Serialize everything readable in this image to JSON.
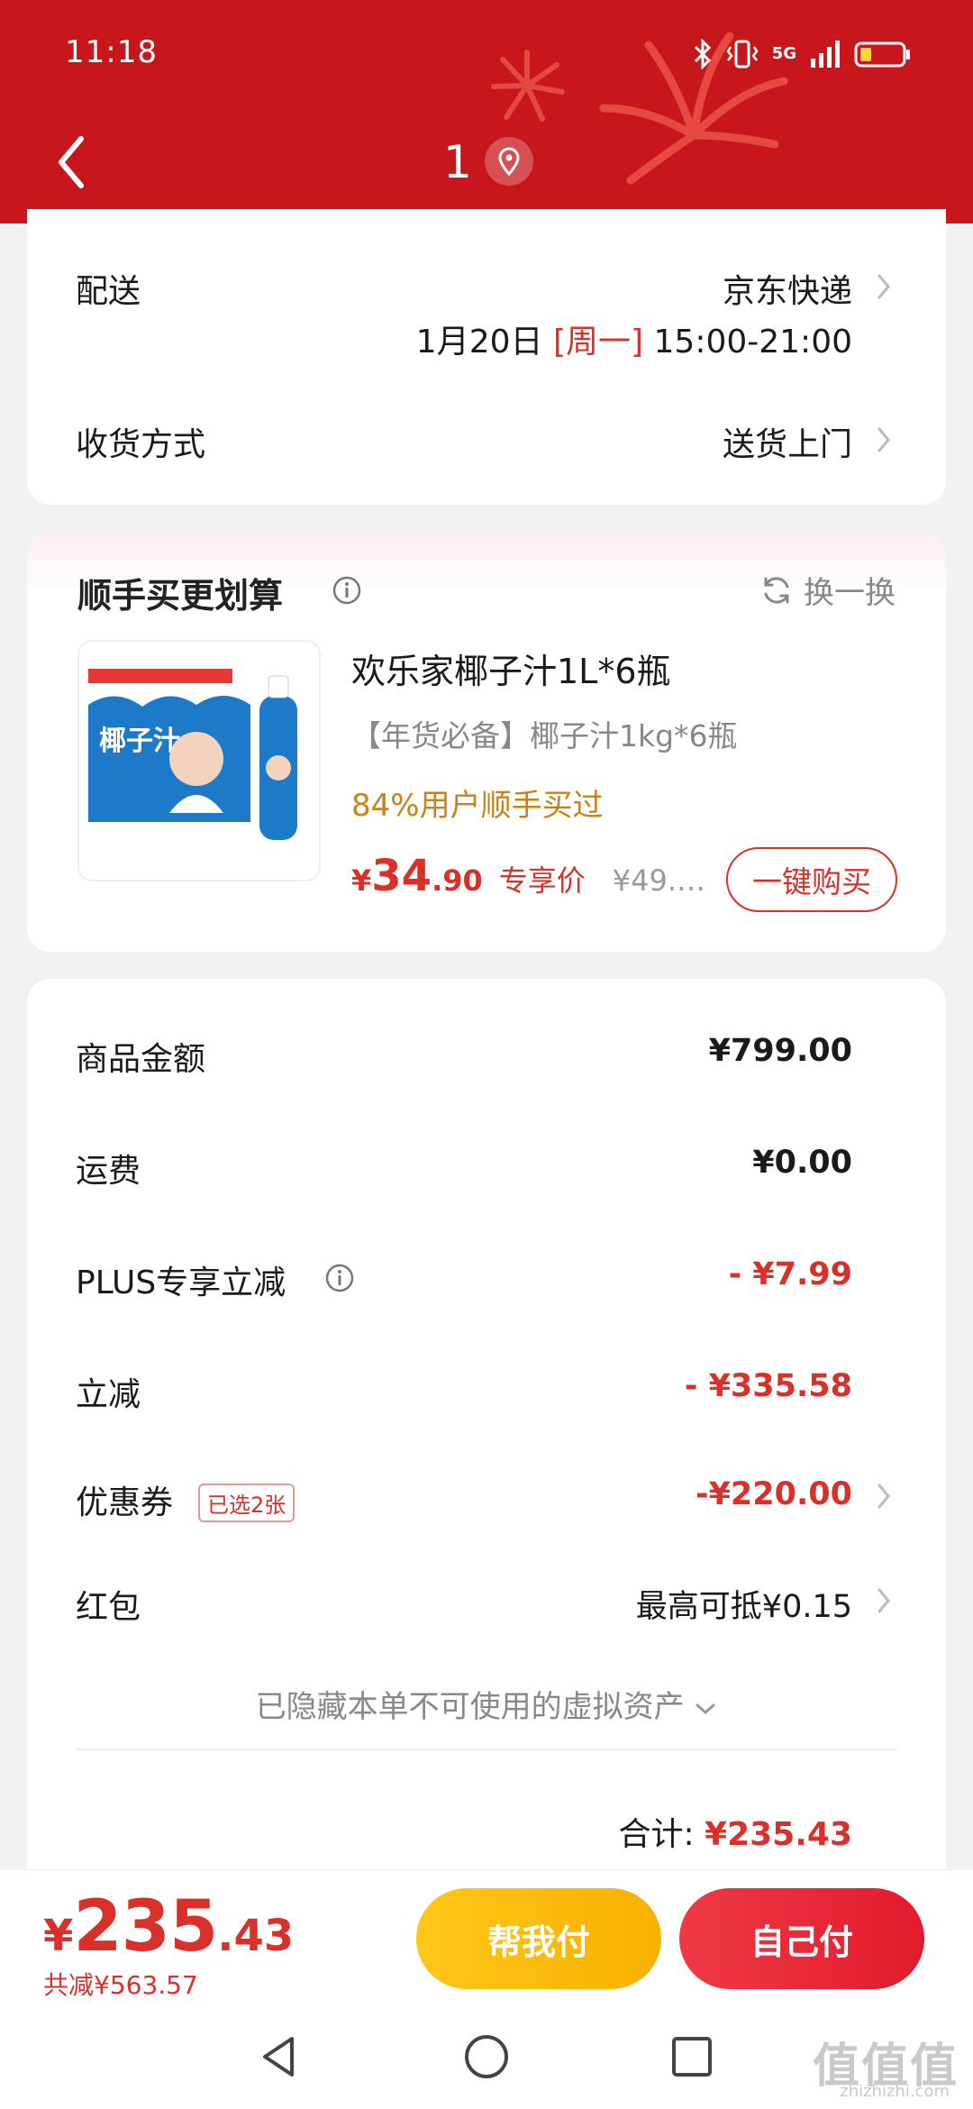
{
  "status": {
    "time": "11:18",
    "network": "5G"
  },
  "nav": {
    "title": "1"
  },
  "delivery": {
    "label": "配送",
    "carrier": "京东快递",
    "date": "1月20日",
    "weekday": "[周一]",
    "time_window": "15:00-21:00",
    "receive_label": "收货方式",
    "receive_value": "送货上门"
  },
  "recommend": {
    "title": "顺手买更划算",
    "swap_label": "换一换",
    "product": {
      "name": "欢乐家椰子汁1L*6瓶",
      "subtitle": "【年货必备】椰子汁1kg*6瓶",
      "social": "84%用户顺手买过",
      "price_currency": "¥",
      "price_int": "34",
      "price_dec": ".90",
      "price_tag": "专享价",
      "original_price": "¥49.…",
      "buy_label": "一键购买",
      "image_text": "椰子汁"
    }
  },
  "summary": {
    "rows": [
      {
        "label": "商品金额",
        "value": "¥799.00"
      },
      {
        "label": "运费",
        "value": "¥0.00"
      },
      {
        "label": "PLUS专享立减",
        "value": "- ¥7.99"
      },
      {
        "label": "立减",
        "value": "- ¥335.58"
      },
      {
        "label": "优惠券",
        "value": "-¥220.00"
      },
      {
        "label": "红包",
        "value": "最高可抵¥0.15"
      }
    ],
    "coupon_badge": "已选2张",
    "hidden_note": "已隐藏本单不可使用的虚拟资产",
    "total_label": "合计:",
    "total_value": "¥235.43"
  },
  "bottom": {
    "currency": "¥",
    "price_int": "235",
    "price_dec": ".43",
    "saved": "共减¥563.57",
    "help_pay": "帮我付",
    "self_pay": "自己付"
  },
  "watermark": {
    "main": "值值值",
    "sub": "zhizhizhi.com"
  },
  "colors": {
    "brand_red": "#c8161d",
    "price_red": "#d9302a",
    "help_yellow": "#ffc719",
    "social_orange": "#c98218"
  }
}
